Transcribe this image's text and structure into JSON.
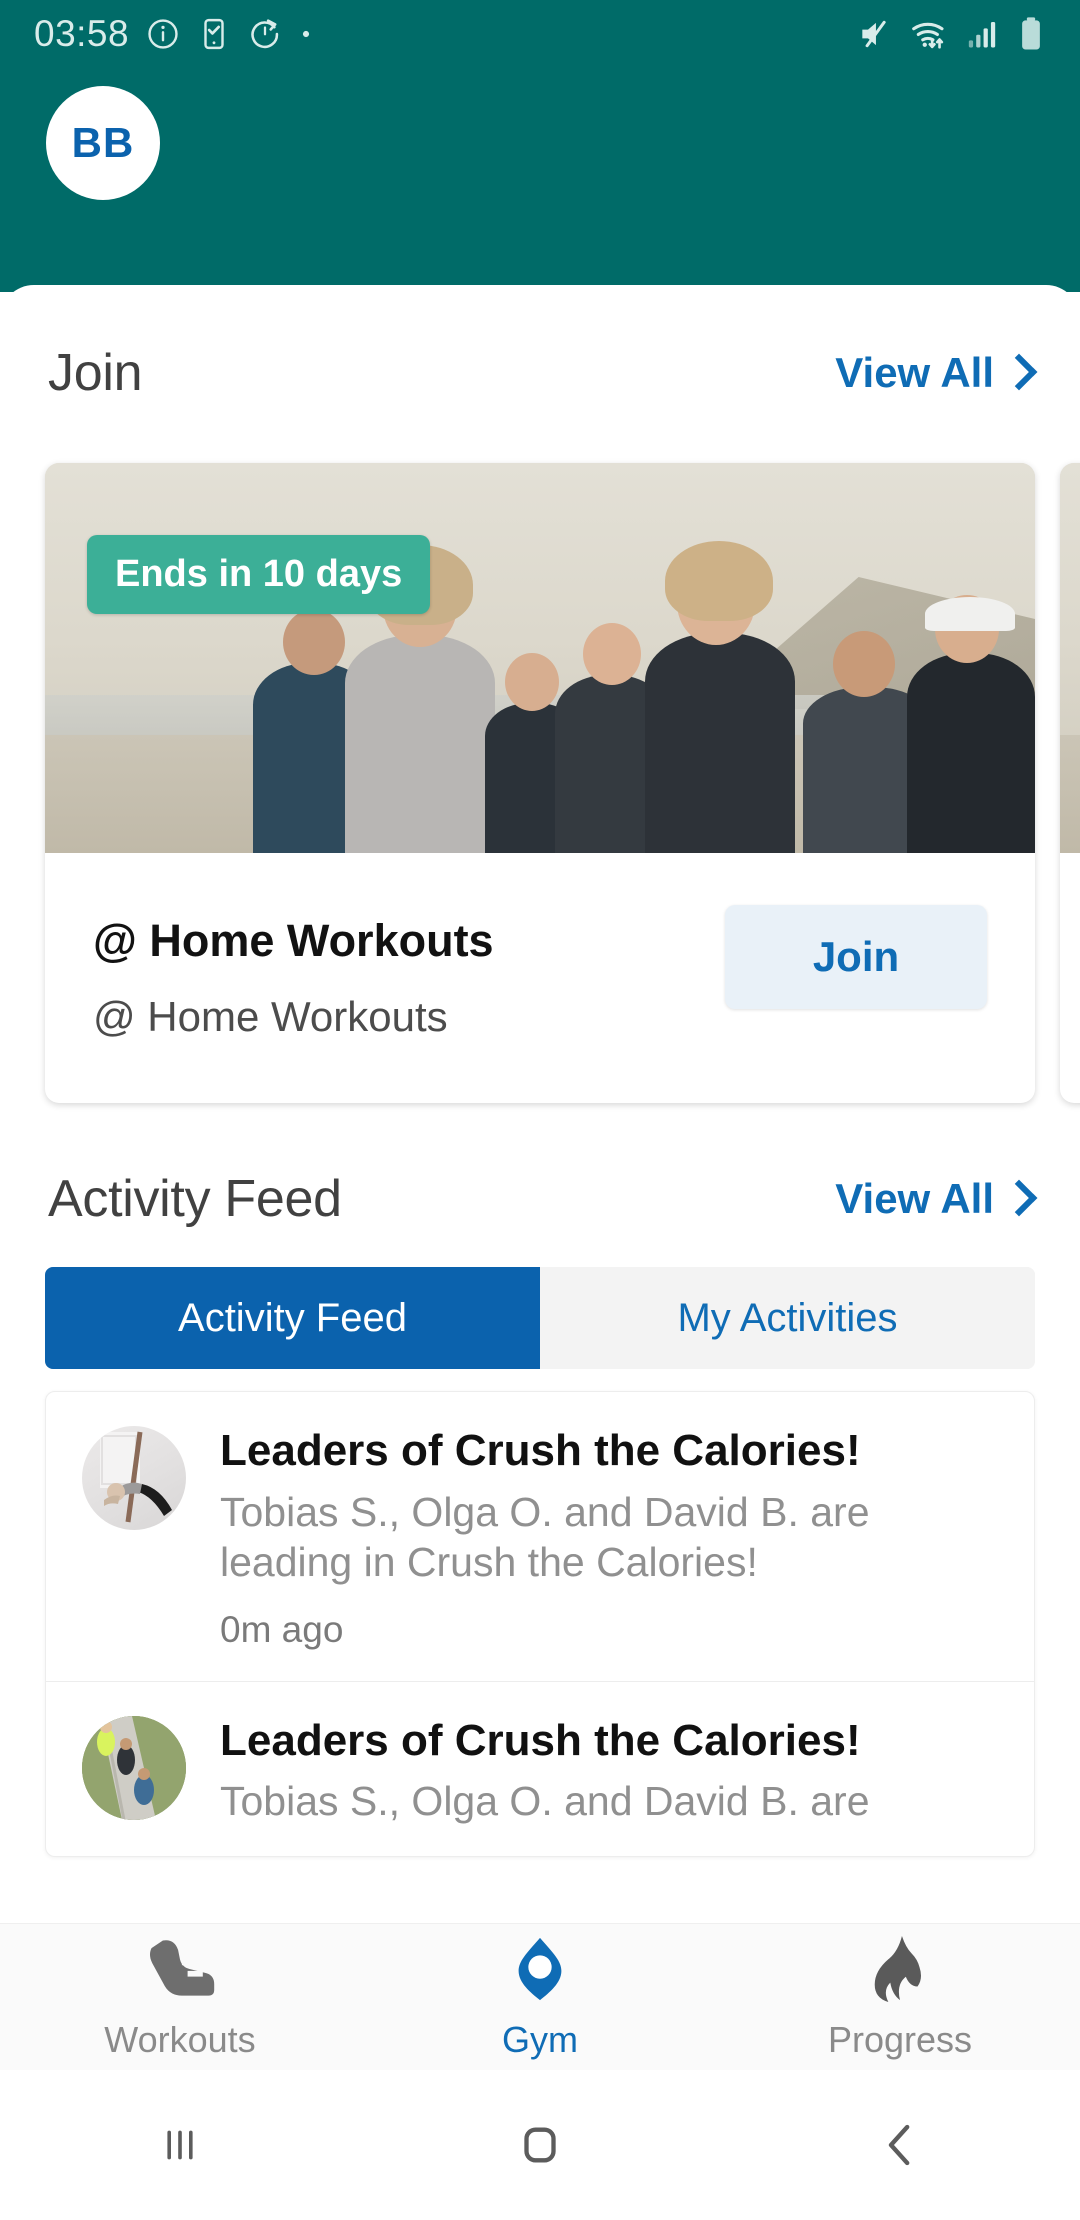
{
  "status_bar": {
    "time": "03:58",
    "left_icons": [
      "info-icon",
      "phone-check-icon",
      "timer-icon",
      "dot-icon"
    ],
    "right_icons": [
      "mute-icon",
      "wifi-icon",
      "signal-icon",
      "battery-icon"
    ]
  },
  "header": {
    "avatar_initials": "BB",
    "background_color": "#006B68"
  },
  "join_section": {
    "title": "Join",
    "view_all": "View All",
    "card": {
      "badge": "Ends in 10 days",
      "title": "@ Home Workouts",
      "subtitle": "@ Home Workouts",
      "action": "Join"
    }
  },
  "activity_section": {
    "title": "Activity Feed",
    "view_all": "View All",
    "tabs": [
      {
        "label": "Activity Feed",
        "active": true
      },
      {
        "label": "My Activities",
        "active": false
      }
    ],
    "items": [
      {
        "title": "Leaders of Crush the Calories!",
        "description": "Tobias S., Olga O. and David B. are leading in Crush the Calories!",
        "time": "0m ago",
        "avatar": "yoga-photo"
      },
      {
        "title": "Leaders of Crush the Calories!",
        "description": "Tobias S., Olga O. and David B. are",
        "time": "",
        "avatar": "runners-photo"
      }
    ]
  },
  "bottom_nav": [
    {
      "label": "Workouts",
      "icon": "shoe-icon",
      "active": false
    },
    {
      "label": "Gym",
      "icon": "location-pin-icon",
      "active": true
    },
    {
      "label": "Progress",
      "icon": "flame-icon",
      "active": false
    }
  ],
  "android_nav": [
    "recents-icon",
    "home-icon",
    "back-icon"
  ],
  "colors": {
    "teal": "#006B68",
    "blue": "#0F6CB5",
    "tab_active": "#0B62AD",
    "badge_green": "#3CAF97",
    "join_button_bg": "#E9F1F8"
  }
}
